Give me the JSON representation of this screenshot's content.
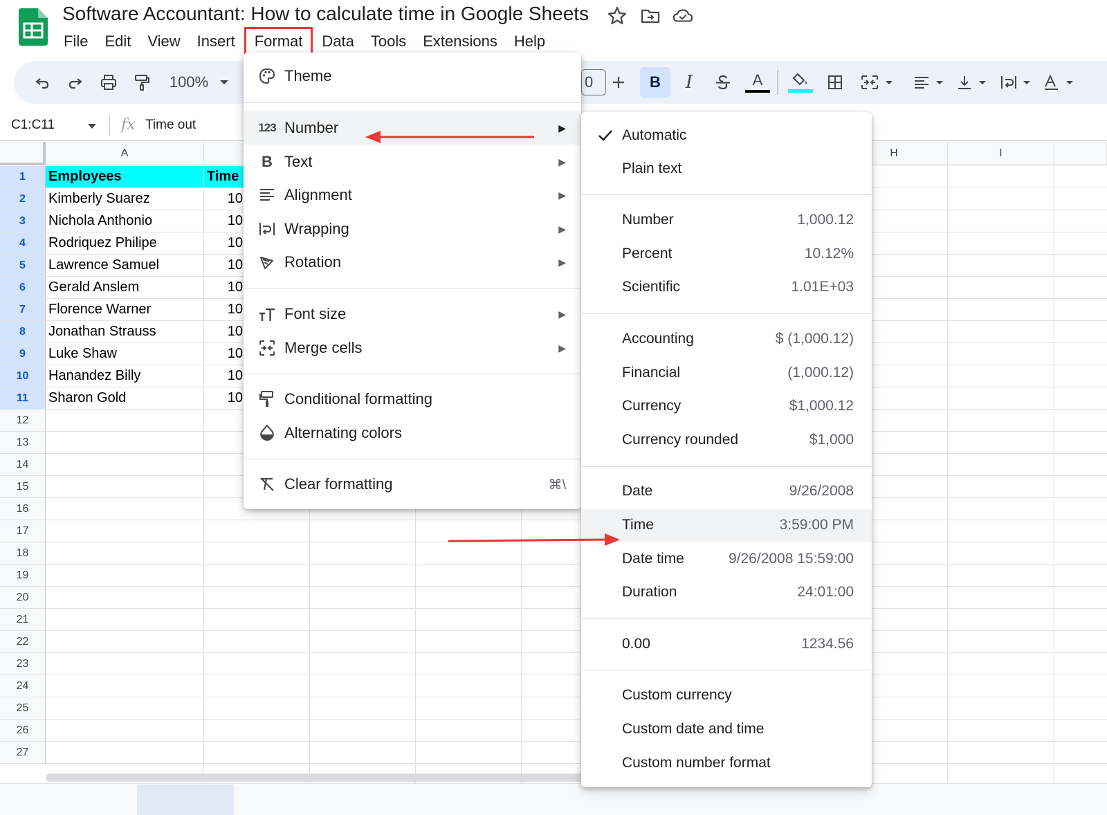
{
  "app": {
    "doc_title": "Software Accountant: How to calculate time in Google Sheets",
    "menu": [
      "File",
      "Edit",
      "View",
      "Insert",
      "Format",
      "Data",
      "Tools",
      "Extensions",
      "Help"
    ]
  },
  "toolbar": {
    "zoom": "100%",
    "font_size_partial": "0",
    "bold_label": "B",
    "italic_label": "I",
    "text_color_label": "A",
    "text_color": "#000000",
    "fill_color": "#00ffff"
  },
  "formula_bar": {
    "name_box": "C1:C11",
    "fx": "fx",
    "content": "Time out"
  },
  "grid": {
    "columns": [
      "A",
      "",
      "",
      "",
      "",
      "",
      "",
      "H",
      "I"
    ],
    "rows": [
      "1",
      "2",
      "3",
      "4",
      "5",
      "6",
      "7",
      "8",
      "9",
      "10",
      "11",
      "12",
      "13",
      "14",
      "15",
      "16",
      "17",
      "18",
      "19",
      "20",
      "21",
      "22",
      "23",
      "24",
      "25",
      "26",
      "27"
    ],
    "header": {
      "a": "Employees",
      "b": "Time"
    },
    "employees": [
      {
        "name": "Kimberly Suarez",
        "time": "10"
      },
      {
        "name": "Nichola Anthonio",
        "time": "10"
      },
      {
        "name": "Rodriquez Philipe",
        "time": "10"
      },
      {
        "name": "Lawrence Samuel",
        "time": "10"
      },
      {
        "name": "Gerald Anslem",
        "time": "10"
      },
      {
        "name": "Florence Warner",
        "time": "10"
      },
      {
        "name": "Jonathan Strauss",
        "time": "10"
      },
      {
        "name": "Luke Shaw",
        "time": "10"
      },
      {
        "name": "Hanandez Billy",
        "time": "10"
      },
      {
        "name": "Sharon Gold",
        "time": "10"
      }
    ],
    "header_fill": "#00ffff",
    "selection_color": "#d3e3fd"
  },
  "format_menu": {
    "theme": "Theme",
    "number": "Number",
    "text": "Text",
    "alignment": "Alignment",
    "wrapping": "Wrapping",
    "rotation": "Rotation",
    "font_size": "Font size",
    "merge_cells": "Merge cells",
    "conditional_formatting": "Conditional formatting",
    "alternating_colors": "Alternating colors",
    "clear_formatting": "Clear formatting",
    "clear_formatting_shortcut": "⌘\\",
    "submenu_glyph": "▶",
    "number_icon_text": "123",
    "text_icon_text": "B"
  },
  "number_menu": {
    "automatic": "Automatic",
    "plain_text": "Plain text",
    "number": {
      "label": "Number",
      "example": "1,000.12"
    },
    "percent": {
      "label": "Percent",
      "example": "10.12%"
    },
    "scientific": {
      "label": "Scientific",
      "example": "1.01E+03"
    },
    "accounting": {
      "label": "Accounting",
      "example": "$ (1,000.12)"
    },
    "financial": {
      "label": "Financial",
      "example": "(1,000.12)"
    },
    "currency": {
      "label": "Currency",
      "example": "$1,000.12"
    },
    "currency_rounded": {
      "label": "Currency rounded",
      "example": "$1,000"
    },
    "date": {
      "label": "Date",
      "example": "9/26/2008"
    },
    "time": {
      "label": "Time",
      "example": "3:59:00 PM"
    },
    "date_time": {
      "label": "Date time",
      "example": "9/26/2008 15:59:00"
    },
    "duration": {
      "label": "Duration",
      "example": "24:01:00"
    },
    "decimal": {
      "label": "0.00",
      "example": "1234.56"
    },
    "custom_currency": "Custom currency",
    "custom_date_time": "Custom date and time",
    "custom_number_format": "Custom number format"
  },
  "annotations": {
    "arrow_color": "#e53935",
    "highlight_box_color": "#e53935"
  }
}
